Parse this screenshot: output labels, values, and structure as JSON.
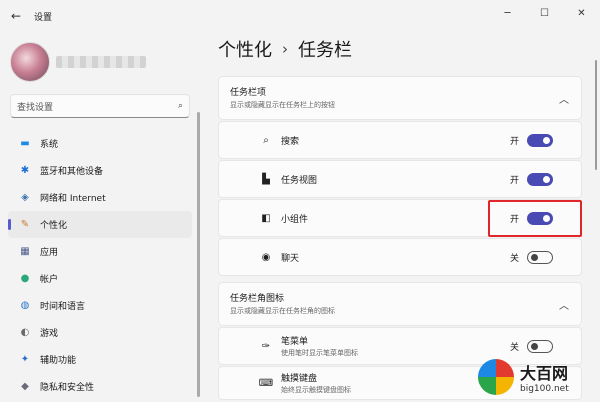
{
  "window": {
    "title": "设置",
    "back_glyph": "←",
    "minimize_glyph": "─",
    "maximize_glyph": "☐",
    "close_glyph": "✕"
  },
  "sidebar": {
    "search_placeholder": "查找设置",
    "search_icon": "search-icon",
    "items": [
      {
        "label": "系统",
        "icon": "monitor-icon",
        "glyph": "▬",
        "color": "#1e88e5"
      },
      {
        "label": "蓝牙和其他设备",
        "icon": "bluetooth-icon",
        "glyph": "✱",
        "color": "#1e6fd6"
      },
      {
        "label": "网络和 Internet",
        "icon": "wifi-icon",
        "glyph": "◈",
        "color": "#3a6fb0"
      },
      {
        "label": "个性化",
        "icon": "brush-icon",
        "glyph": "✎",
        "color": "#c77a2a"
      },
      {
        "label": "应用",
        "icon": "apps-icon",
        "glyph": "▦",
        "color": "#4a5a8a"
      },
      {
        "label": "帐户",
        "icon": "account-icon",
        "glyph": "●",
        "color": "#2aa87a"
      },
      {
        "label": "时间和语言",
        "icon": "globe-clock-icon",
        "glyph": "◍",
        "color": "#2a78c8"
      },
      {
        "label": "游戏",
        "icon": "gamepad-icon",
        "glyph": "◐",
        "color": "#6a6a6a"
      },
      {
        "label": "辅助功能",
        "icon": "accessibility-icon",
        "glyph": "✦",
        "color": "#2a6fc8"
      },
      {
        "label": "隐私和安全性",
        "icon": "shield-icon",
        "glyph": "◆",
        "color": "#6a6a7a"
      }
    ],
    "active_index": 3
  },
  "breadcrumb": {
    "parent": "个性化",
    "separator": "›",
    "current": "任务栏"
  },
  "sections": [
    {
      "title": "任务栏项",
      "description": "显示或隐藏显示在任务栏上的按钮",
      "expanded": true,
      "items": [
        {
          "label": "搜索",
          "icon": "search-icon",
          "glyph": "⌕",
          "state": "开",
          "on": true
        },
        {
          "label": "任务视图",
          "icon": "task-view-icon",
          "glyph": "▙",
          "state": "开",
          "on": true
        },
        {
          "label": "小组件",
          "icon": "widgets-icon",
          "glyph": "◧",
          "state": "开",
          "on": true
        },
        {
          "label": "聊天",
          "icon": "chat-icon",
          "glyph": "◉",
          "state": "关",
          "on": false
        }
      ]
    },
    {
      "title": "任务栏角图标",
      "description": "显示或隐藏显示在任务栏角的图标",
      "expanded": true,
      "items": [
        {
          "label": "笔菜单",
          "sublabel": "使用笔时显示笔菜单图标",
          "icon": "pen-icon",
          "glyph": "✑",
          "state": "关",
          "on": false
        },
        {
          "label": "触摸键盘",
          "sublabel": "始终显示触摸键盘图标",
          "icon": "keyboard-icon",
          "glyph": "⌨"
        }
      ]
    }
  ],
  "watermark": {
    "brand": "大百网",
    "url": "big100.net"
  },
  "colors": {
    "accent": "#4a4ab4",
    "highlight": "#e0262b"
  }
}
